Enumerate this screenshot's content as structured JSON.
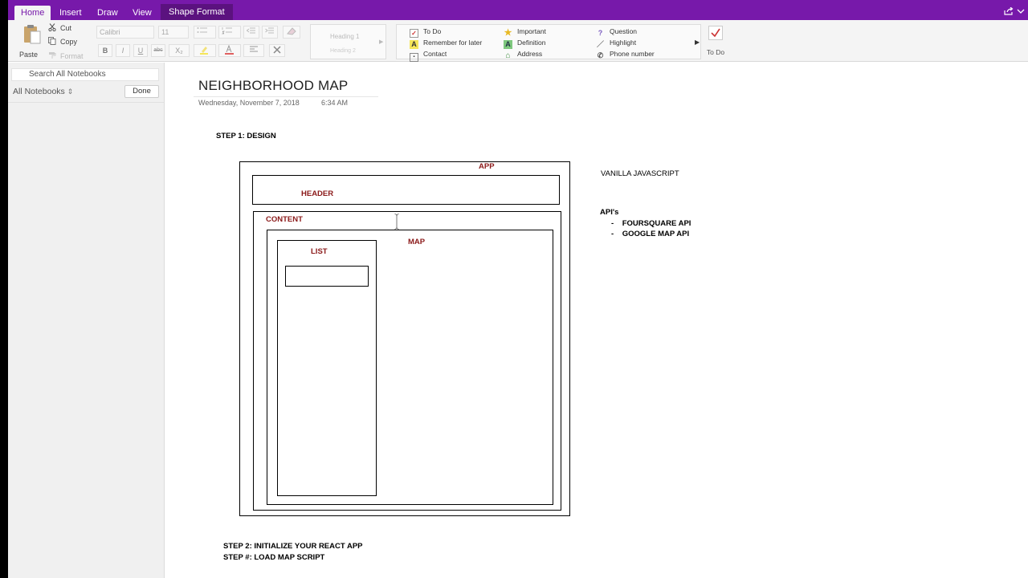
{
  "tabs": [
    {
      "label": "Home"
    },
    {
      "label": "Insert"
    },
    {
      "label": "Draw"
    },
    {
      "label": "View"
    },
    {
      "label": "Shape Format"
    }
  ],
  "ribbon": {
    "paste": "Paste",
    "cut": "Cut",
    "copy": "Copy",
    "format": "Format",
    "font_name": "Calibri",
    "font_size": "11",
    "bold": "B",
    "italic": "I",
    "underline": "U",
    "strike": "abc",
    "subscript": "X₂",
    "styles": [
      "Heading 1",
      "Heading 2"
    ],
    "tags": [
      {
        "label": "To Do",
        "icon": "checkbox-icon"
      },
      {
        "label": "Remember for later",
        "icon": "highlight-a-icon"
      },
      {
        "label": "Contact",
        "icon": "contact-card-icon"
      },
      {
        "label": "Important",
        "icon": "star-icon"
      },
      {
        "label": "Definition",
        "icon": "definition-a-icon"
      },
      {
        "label": "Address",
        "icon": "house-icon"
      },
      {
        "label": "Question",
        "icon": "question-icon"
      },
      {
        "label": "Highlight",
        "icon": "pen-icon"
      },
      {
        "label": "Phone number",
        "icon": "phone-icon"
      }
    ],
    "todo": "To Do"
  },
  "sidebar": {
    "search_placeholder": "Search All Notebooks",
    "notebooks_label": "All Notebooks",
    "done": "Done"
  },
  "page": {
    "title": "NEIGHBORHOOD MAP",
    "date": "Wednesday, November 7, 2018",
    "time": "6:34 AM",
    "step1": "STEP 1: DESIGN",
    "step2": "STEP 2: INITIALIZE YOUR REACT APP",
    "step3": "STEP #: LOAD MAP SCRIPT",
    "diagram": {
      "app": "APP",
      "header": "HEADER",
      "content": "CONTENT",
      "map": "MAP",
      "list": "LIST"
    },
    "notes": {
      "tech": "VANILLA JAVASCRIPT",
      "apis_heading": "API's",
      "apis": [
        "FOURSQUARE API",
        "GOOGLE MAP API"
      ]
    }
  },
  "colors": {
    "brand": "#7719aa",
    "diagram_label": "#8b1a1a"
  }
}
